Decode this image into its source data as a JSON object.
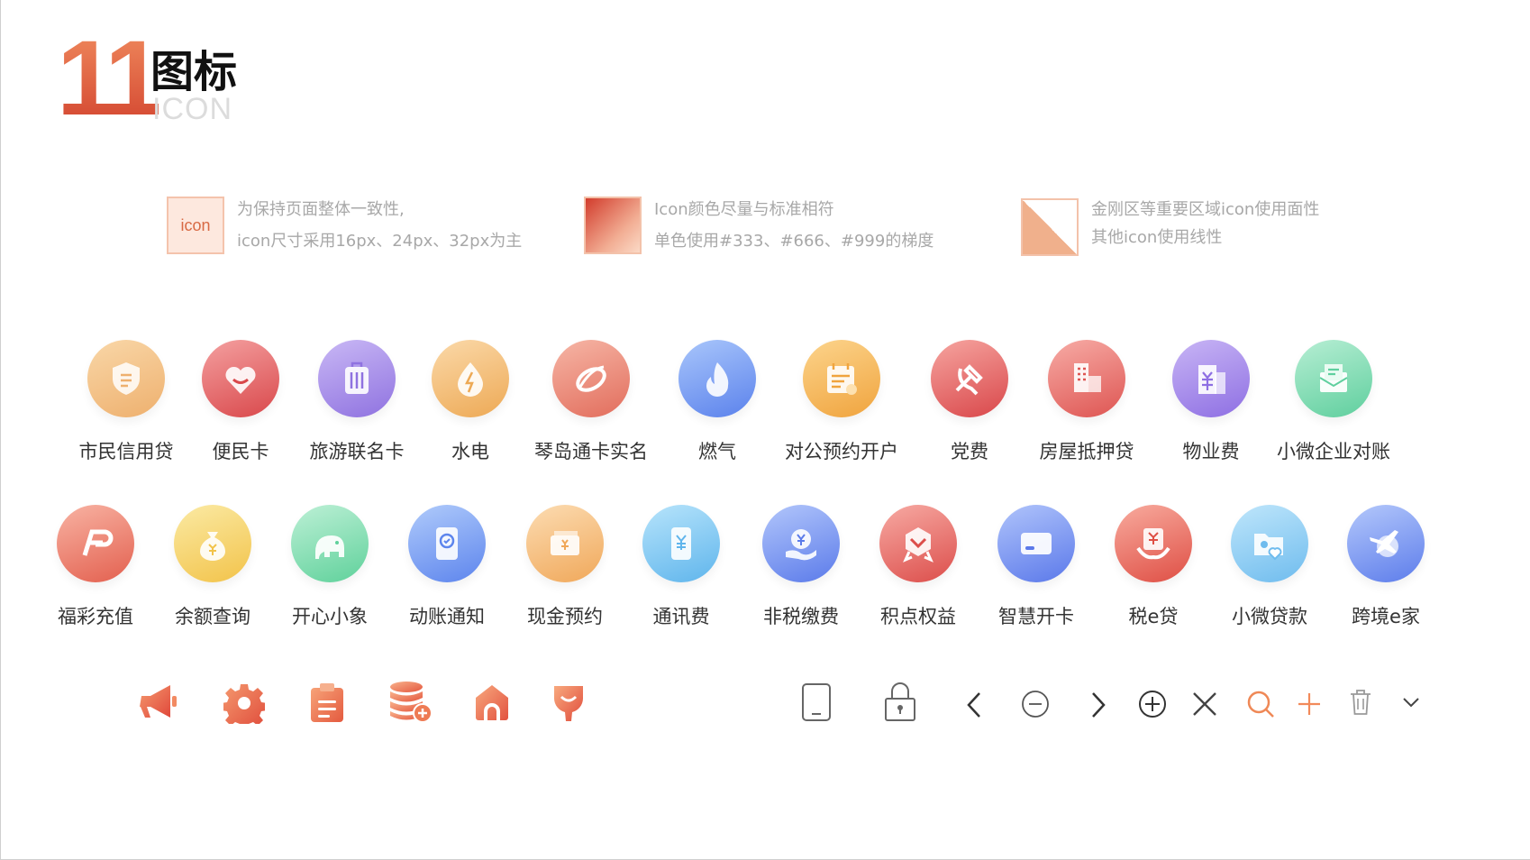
{
  "header": {
    "number": "11",
    "title": "图标",
    "subtitle": "ICON"
  },
  "rules": [
    {
      "swatch_text": "icon",
      "line1": "为保持页面整体一致性,",
      "line2": "icon尺寸采用16px、24px、32px为主"
    },
    {
      "line1": "Icon颜色尽量与标准相符",
      "line2": "单色使用#333、#666、#999的梯度"
    },
    {
      "line1": "金刚区等重要区域icon使用面性",
      "line2": "其他icon使用线性"
    }
  ],
  "row1": [
    {
      "label": "市民信用贷",
      "icon": "shield-icon",
      "c1": "#f9d7a8",
      "c2": "#eeb06e"
    },
    {
      "label": "便民卡",
      "icon": "heart-card-icon",
      "c1": "#f4a0a0",
      "c2": "#d9484b"
    },
    {
      "label": "旅游联名卡",
      "icon": "suitcase-icon",
      "c1": "#c9b8f5",
      "c2": "#8f72e0"
    },
    {
      "label": "水电",
      "icon": "water-electric-icon",
      "c1": "#fbd9a9",
      "c2": "#eda955"
    },
    {
      "label": "琴岛通卡实名",
      "icon": "ring-icon",
      "c1": "#f6b6a6",
      "c2": "#e26d5c"
    },
    {
      "label": "燃气",
      "icon": "flame-icon",
      "c1": "#a9c6fb",
      "c2": "#5b82ec"
    },
    {
      "label": "对公预约开户",
      "icon": "calendar-icon",
      "c1": "#fcd48c",
      "c2": "#f0a43e"
    },
    {
      "label": "党费",
      "icon": "hammer-sickle-icon",
      "c1": "#f6a5a0",
      "c2": "#d9474a"
    },
    {
      "label": "房屋抵押贷",
      "icon": "building-icon",
      "c1": "#f7aca6",
      "c2": "#de5552"
    },
    {
      "label": "物业费",
      "icon": "property-icon",
      "c1": "#c8b5f5",
      "c2": "#8e6fe3"
    },
    {
      "label": "小微企业对账",
      "icon": "envelope-icon",
      "c1": "#b7eed4",
      "c2": "#5fcf9e"
    }
  ],
  "row2": [
    {
      "label": "福彩充值",
      "icon": "lottery-icon",
      "c1": "#f8b3a3",
      "c2": "#e3604f"
    },
    {
      "label": "余额查询",
      "icon": "money-bag-icon",
      "c1": "#fbeaa4",
      "c2": "#f2c34a"
    },
    {
      "label": "开心小象",
      "icon": "elephant-icon",
      "c1": "#bdf0d6",
      "c2": "#5fd19b"
    },
    {
      "label": "动账通知",
      "icon": "phone-notify-icon",
      "c1": "#b0cbfb",
      "c2": "#5d85ed"
    },
    {
      "label": "现金预约",
      "icon": "cash-icon",
      "c1": "#fcdcb2",
      "c2": "#f0a85a"
    },
    {
      "label": "通讯费",
      "icon": "phone-yuan-icon",
      "c1": "#b7e4fb",
      "c2": "#5fb5ec"
    },
    {
      "label": "非税缴费",
      "icon": "hand-coin-icon",
      "c1": "#b2c6fb",
      "c2": "#5b7bea"
    },
    {
      "label": "积点权益",
      "icon": "medal-icon",
      "c1": "#f7aaa3",
      "c2": "#dc4e4b"
    },
    {
      "label": "智慧开卡",
      "icon": "card-icon",
      "c1": "#b0c4fb",
      "c2": "#5b79ea"
    },
    {
      "label": "税e贷",
      "icon": "tax-loan-icon",
      "c1": "#f8ab9e",
      "c2": "#df4f45"
    },
    {
      "label": "小微贷款",
      "icon": "folder-heart-icon",
      "c1": "#bfe6fb",
      "c2": "#6fbcee"
    },
    {
      "label": "跨境e家",
      "icon": "plane-globe-icon",
      "c1": "#b4c8fb",
      "c2": "#5d7deb"
    }
  ],
  "accent": "#e8653f"
}
